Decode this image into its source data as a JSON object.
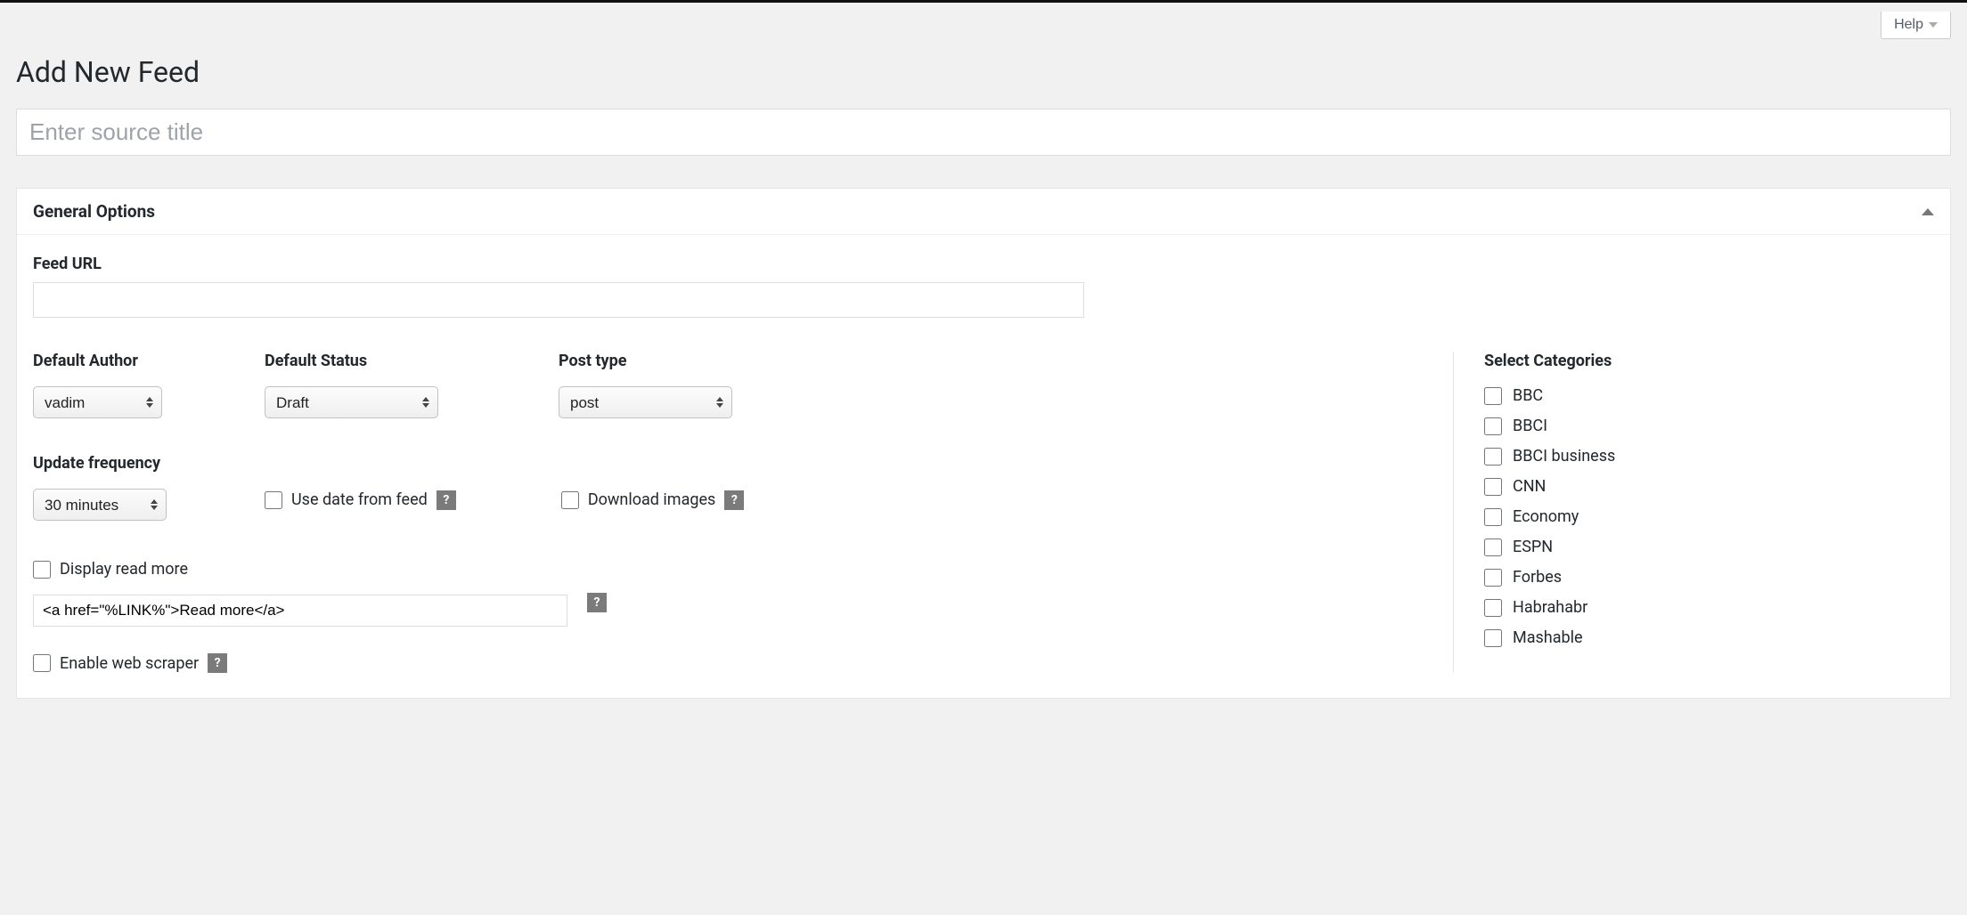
{
  "header": {
    "help_label": "Help",
    "page_title": "Add New Feed",
    "title_placeholder": "Enter source title"
  },
  "panel": {
    "title": "General Options",
    "feed_url_label": "Feed URL",
    "feed_url_value": "",
    "default_author": {
      "label": "Default Author",
      "value": "vadim"
    },
    "default_status": {
      "label": "Default Status",
      "value": "Draft"
    },
    "post_type": {
      "label": "Post type",
      "value": "post"
    },
    "update_frequency": {
      "label": "Update frequency",
      "value": "30 minutes"
    },
    "use_date_from_feed_label": "Use date from feed",
    "download_images_label": "Download images",
    "display_read_more_label": "Display read more",
    "read_more_template": "<a href=\"%LINK%\">Read more</a>",
    "enable_web_scraper_label": "Enable web scraper",
    "help_icon_text": "?",
    "categories": {
      "label": "Select Categories",
      "items": [
        "BBC",
        "BBCI",
        "BBCI business",
        "CNN",
        "Economy",
        "ESPN",
        "Forbes",
        "Habrahabr",
        "Mashable"
      ]
    }
  }
}
